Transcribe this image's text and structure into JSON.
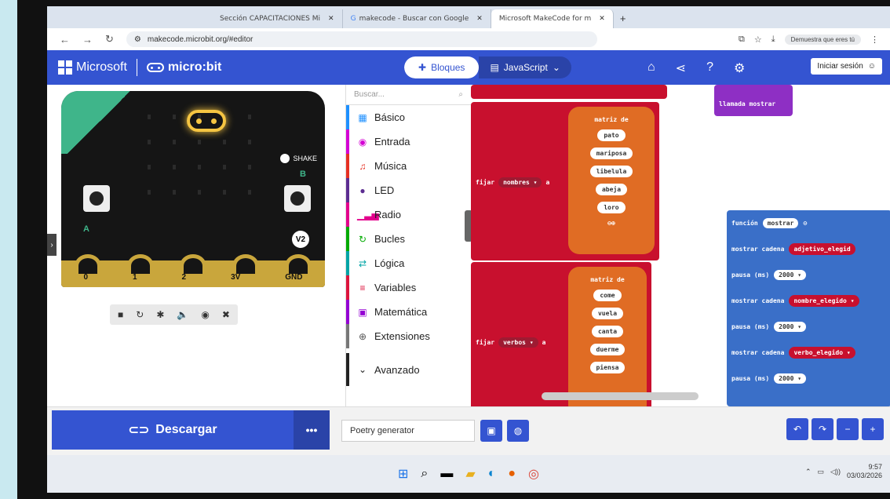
{
  "browser": {
    "tabs": [
      {
        "label": "Sección CAPACITACIONES Mi",
        "active": false
      },
      {
        "label": "makecode - Buscar con Google",
        "active": false
      },
      {
        "label": "Microsoft MakeCode for m",
        "active": true
      }
    ],
    "url": "makecode.microbit.org/#editor",
    "profile_button": "Demuestra que eres tú"
  },
  "header": {
    "brand": "Microsoft",
    "product": "micro:bit",
    "blocks_tab": "Bloques",
    "js_tab": "JavaScript",
    "signin": "Iniciar sesión"
  },
  "simulator": {
    "shake_label": "SHAKE",
    "button_a": "A",
    "button_b": "B",
    "version": "V2",
    "pins": [
      "0",
      "1",
      "2",
      "3V",
      "GND"
    ]
  },
  "toolbox": {
    "search_placeholder": "Buscar...",
    "categories": [
      {
        "label": "Básico",
        "color": "#1e90ff",
        "icon": "grid-icon"
      },
      {
        "label": "Entrada",
        "color": "#d400d4",
        "icon": "circle-icon"
      },
      {
        "label": "Música",
        "color": "#e63022",
        "icon": "headphones-icon"
      },
      {
        "label": "LED",
        "color": "#5c2d91",
        "icon": "toggle-icon"
      },
      {
        "label": "Radio",
        "color": "#e3008c",
        "icon": "bars-icon"
      },
      {
        "label": "Bucles",
        "color": "#00aa00",
        "icon": "refresh-icon"
      },
      {
        "label": "Lógica",
        "color": "#00a4a6",
        "icon": "shuffle-icon"
      },
      {
        "label": "Variables",
        "color": "#dc143c",
        "icon": "list-icon"
      },
      {
        "label": "Matemática",
        "color": "#9400d3",
        "icon": "calculator-icon"
      },
      {
        "label": "Extensiones",
        "color": "#777777",
        "icon": "plus-icon"
      }
    ],
    "advanced": "Avanzado"
  },
  "workspace": {
    "call_label": "llamada mostrar",
    "set1": {
      "prefix": "fijar",
      "var": "nombres",
      "to": "a",
      "array_label": "matriz de",
      "items": [
        "pato",
        "mariposa",
        "libelula",
        "abeja",
        "loro"
      ]
    },
    "set2": {
      "prefix": "fijar",
      "var": "verbos",
      "to": "a",
      "array_label": "matriz de",
      "items": [
        "come",
        "vuela",
        "canta",
        "duerme",
        "piensa"
      ]
    },
    "function": {
      "keyword": "función",
      "name": "mostrar",
      "rows": [
        {
          "label": "mostrar cadena",
          "value": "adjetivo_elegid"
        },
        {
          "label": "pausa (ms)",
          "value": "2000"
        },
        {
          "label": "mostrar cadena",
          "value": "nombre_elegido"
        },
        {
          "label": "pausa (ms)",
          "value": "2000"
        },
        {
          "label": "mostrar cadena",
          "value": "verbo_elegido"
        },
        {
          "label": "pausa (ms)",
          "value": "2000"
        }
      ]
    }
  },
  "bottom": {
    "download": "Descargar",
    "more": "•••",
    "project_name": "Poetry generator"
  },
  "taskbar": {
    "time": "9:57",
    "date": "03/03/2026"
  }
}
